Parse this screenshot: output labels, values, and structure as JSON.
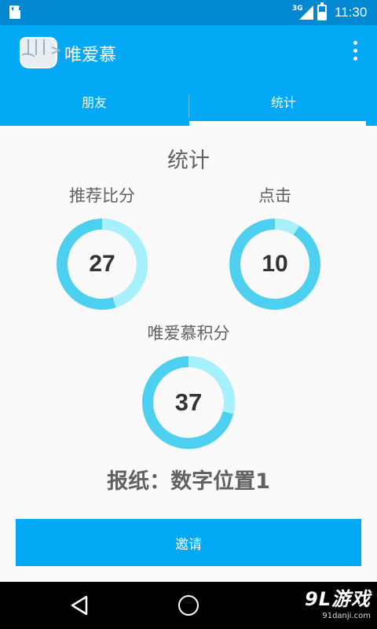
{
  "status_bar": {
    "time": "11:30",
    "network": "3G"
  },
  "app": {
    "title": "唯爱慕"
  },
  "tabs": [
    {
      "label": "朋友",
      "active": false
    },
    {
      "label": "统计",
      "active": true
    }
  ],
  "stats": {
    "title": "统计",
    "recommend": {
      "label": "推荐比分",
      "value": "27",
      "fraction": 0.45
    },
    "click": {
      "label": "点击",
      "value": "10",
      "fraction": 0.09
    },
    "score": {
      "label": "唯爱慕积分",
      "value": "37",
      "fraction": 0.29
    }
  },
  "newspaper_line": "报纸：数字位置1",
  "invite_button_label": "邀请",
  "watermark": {
    "main": "9L游戏",
    "sub": "91danji.com"
  },
  "icons": {
    "sd_card": "sd-card-icon",
    "signal": "signal-icon",
    "battery": "battery-icon",
    "overflow": "overflow-menu-icon",
    "back": "back-icon",
    "home": "home-icon"
  },
  "colors": {
    "status_bar": "#0288d1",
    "primary": "#03a9f4",
    "ring_light": "#a6f1fb",
    "ring_dark": "#4dcfef",
    "text": "#616161",
    "value_text": "#333333"
  }
}
